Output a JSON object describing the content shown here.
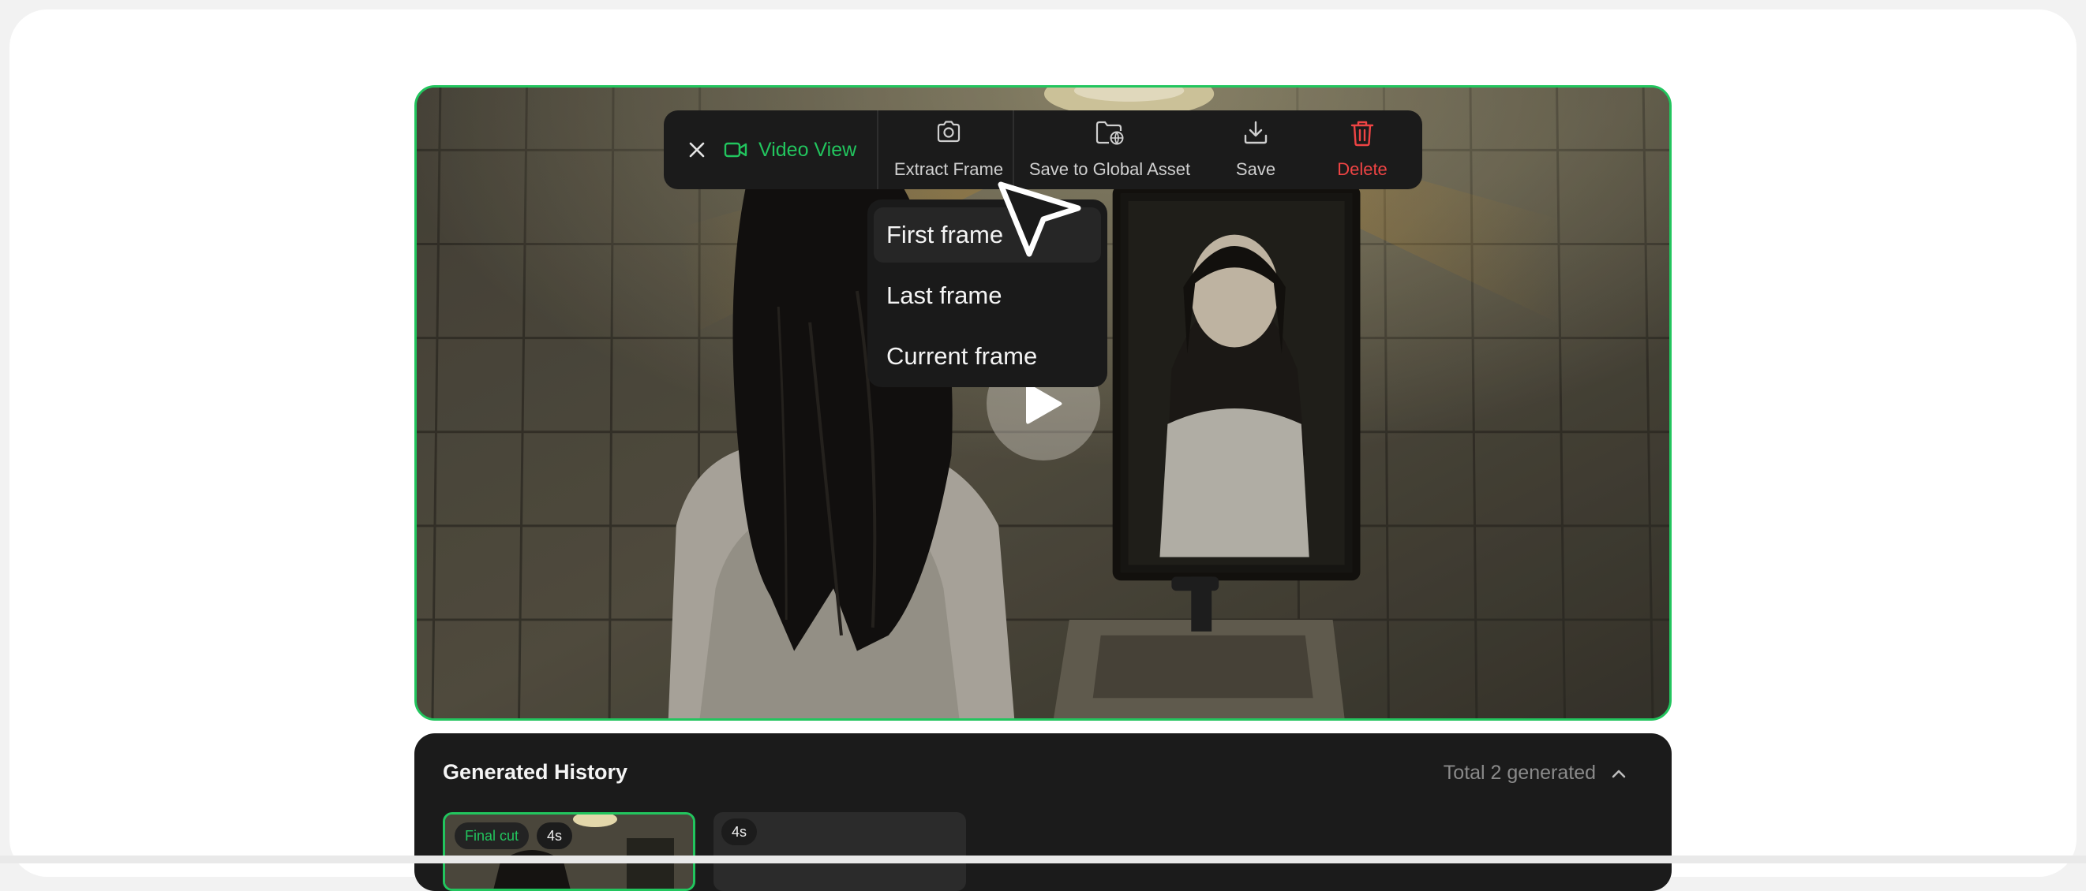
{
  "toolbar": {
    "view_label": "Video View",
    "extract_label": "Extract Frame",
    "global_asset_label": "Save to Global Asset",
    "save_label": "Save",
    "delete_label": "Delete",
    "icons": {
      "close": "close-icon",
      "view": "video-camera-icon",
      "extract": "camera-icon",
      "global_asset": "folder-globe-icon",
      "save": "download-icon",
      "delete": "trash-icon"
    }
  },
  "extract_menu": {
    "items": [
      {
        "label": "First frame",
        "active": true
      },
      {
        "label": "Last frame",
        "active": false
      },
      {
        "label": "Current frame",
        "active": false
      }
    ]
  },
  "player": {
    "play_icon": "play-icon"
  },
  "history": {
    "title": "Generated History",
    "total": "Total 2 generated",
    "collapse_icon": "chevron-up-icon",
    "items": [
      {
        "badge": "Final cut",
        "duration": "4s",
        "selected": true
      },
      {
        "duration": "4s",
        "selected": false
      }
    ]
  },
  "colors": {
    "accent": "#22c55e",
    "danger": "#ef4444",
    "toolbar_bg": "#1b1b1b",
    "panel_bg": "#1b1b1b"
  }
}
